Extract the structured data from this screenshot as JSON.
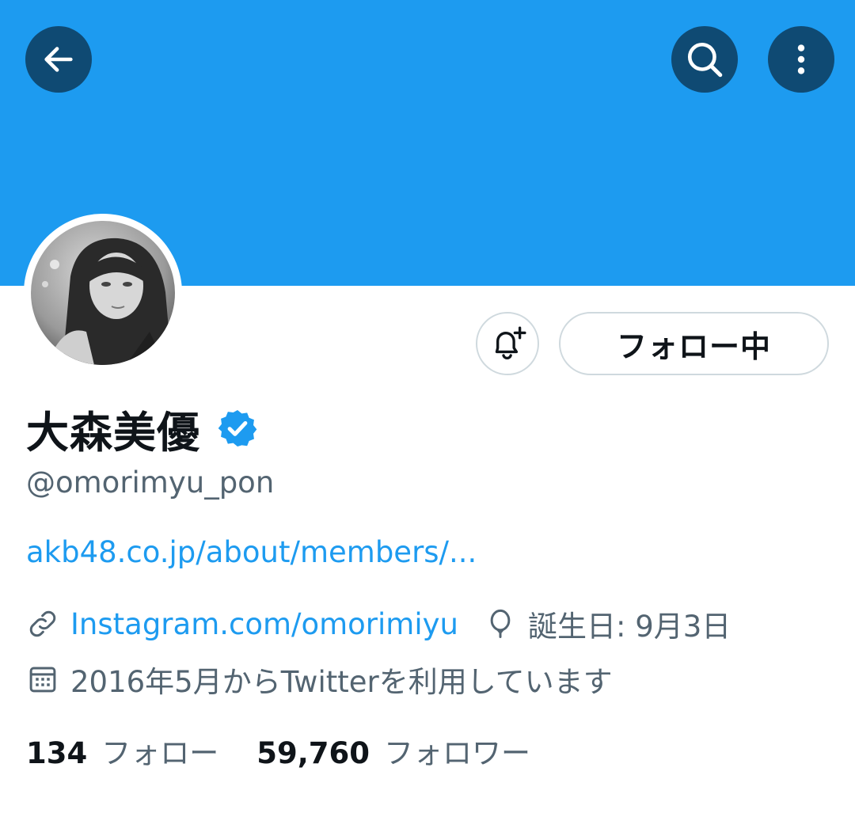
{
  "profile": {
    "display_name": "大森美優",
    "handle": "@omorimyu_pon",
    "bio_link": "akb48.co.jp/about/members/...",
    "website": "Instagram.com/omorimiyu",
    "birthday": "誕生日: 9月3日",
    "joined": "2016年5月からTwitterを利用しています"
  },
  "actions": {
    "follow_label": "フォロー中"
  },
  "stats": {
    "following_count": "134",
    "following_label": "フォロー",
    "followers_count": "59,760",
    "followers_label": "フォロワー"
  },
  "icons": {
    "back": "arrow-left-icon",
    "search": "search-icon",
    "more": "more-vertical-icon",
    "notify": "bell-plus-icon",
    "verified": "verified-badge-icon",
    "link": "link-icon",
    "birthday": "balloon-icon",
    "calendar": "calendar-icon"
  },
  "colors": {
    "banner": "#1d9bf0",
    "accent": "#1d9bf0",
    "text": "#0f1419",
    "muted": "#536471"
  }
}
